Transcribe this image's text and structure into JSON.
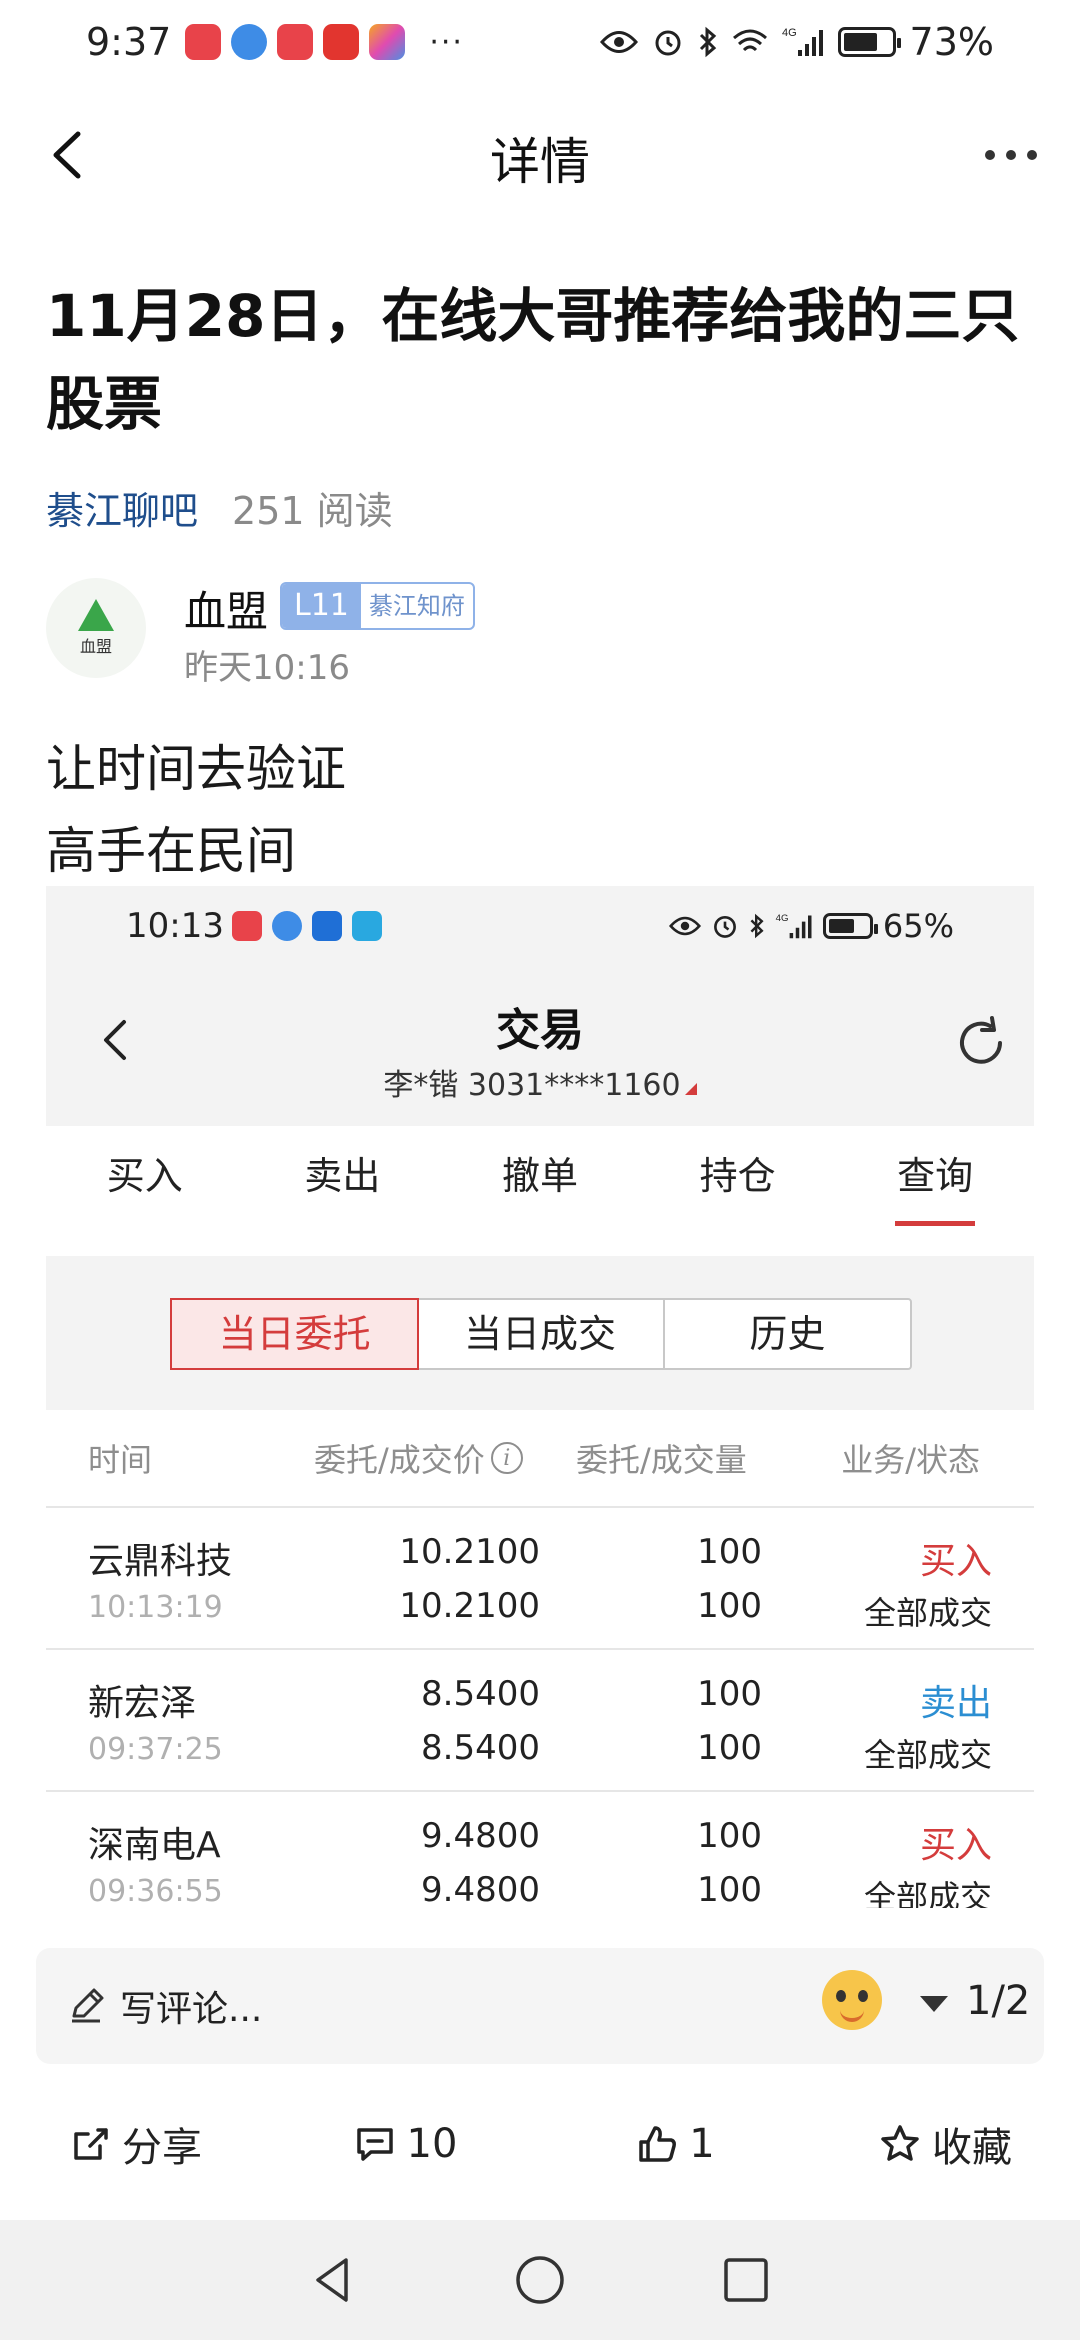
{
  "status_bar": {
    "time": "9:37",
    "battery": "73%",
    "battery_level": 0.73,
    "network": "4G"
  },
  "nav": {
    "title": "详情"
  },
  "article": {
    "title": "11月28日，在线大哥推荐给我的三只股票",
    "group": "綦江聊吧",
    "reads": "251 阅读",
    "author": {
      "name": "血盟",
      "avatar_text": "血盟",
      "level": "L11",
      "badge": "綦江知府",
      "time": "昨天10:16"
    },
    "lines": [
      "让时间去验证",
      "高手在民间"
    ]
  },
  "embedded": {
    "status_bar": {
      "time": "10:13",
      "battery": "65%",
      "battery_level": 0.65,
      "network": "4G"
    },
    "nav": {
      "title": "交易",
      "account": "李*锴 3031****1160"
    },
    "tabs": [
      "买入",
      "卖出",
      "撤单",
      "持仓",
      "查询"
    ],
    "active_tab": "查询",
    "segments": [
      "当日委托",
      "当日成交",
      "历史"
    ],
    "active_segment": "当日委托",
    "columns": [
      "时间",
      "委托/成交价",
      "委托/成交量",
      "业务/状态"
    ],
    "rows": [
      {
        "name": "云鼎科技",
        "time": "10:13:19",
        "price_order": "10.2100",
        "price_deal": "10.2100",
        "qty_order": "100",
        "qty_deal": "100",
        "side": "买入",
        "side_type": "buy",
        "status": "全部成交"
      },
      {
        "name": "新宏泽",
        "time": "09:37:25",
        "price_order": "8.5400",
        "price_deal": "8.5400",
        "qty_order": "100",
        "qty_deal": "100",
        "side": "卖出",
        "side_type": "sell",
        "status": "全部成交"
      },
      {
        "name": "深南电A",
        "time": "09:36:55",
        "price_order": "9.4800",
        "price_deal": "9.4800",
        "qty_order": "100",
        "qty_deal": "100",
        "side": "买入",
        "side_type": "buy",
        "status": "全部成交"
      }
    ]
  },
  "comment_bar": {
    "placeholder": "写评论...",
    "page": "1/2"
  },
  "actions": {
    "share": "分享",
    "comments": "10",
    "likes": "1",
    "favorite": "收藏"
  },
  "colors": {
    "accent_red": "#d43c3c",
    "sell_blue": "#2b8ed2",
    "group_blue": "#1f4e8c",
    "badge_blue": "#8fb2e8"
  }
}
